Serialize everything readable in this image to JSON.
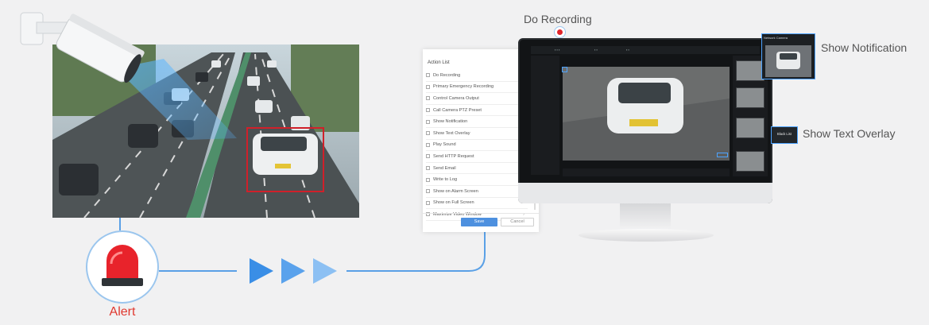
{
  "alert": {
    "label": "Alert",
    "icon": "siren-icon"
  },
  "action_panel": {
    "title": "Action List",
    "items": [
      "Do Recording",
      "Primary Emergency Recording",
      "Control Camera Output",
      "Call Camera PTZ Preset",
      "Show Notification",
      "Show Text Overlay",
      "Play Sound",
      "Send HTTP Request",
      "Send Email",
      "Write to Log",
      "Show on Alarm Screen",
      "Show on Full Screen",
      "Maximize Video Window"
    ],
    "save_label": "Save",
    "cancel_label": "Cancel"
  },
  "callouts": {
    "do_recording": "Do Recording",
    "show_notification": "Show Notification",
    "show_text_overlay": "Show Text Overlay"
  },
  "monitor": {
    "overlay_text": "Black List",
    "notification_header": "Network Camera"
  },
  "colors": {
    "accent_blue": "#4da3ff",
    "flow_blue": "#3a8ee6",
    "alert_red": "#e0382f",
    "detect_red": "#d0202a"
  }
}
